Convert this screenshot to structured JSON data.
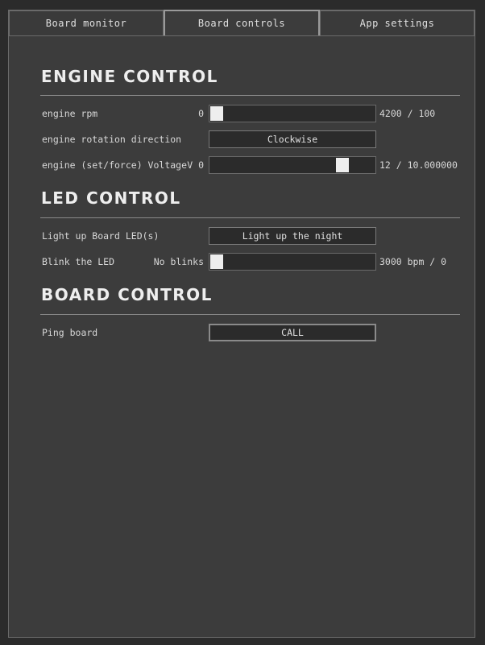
{
  "tabs": [
    {
      "label": "Board monitor"
    },
    {
      "label": "Board controls"
    },
    {
      "label": "App settings"
    }
  ],
  "engine": {
    "title": "ENGINE CONTROL",
    "rpm": {
      "label": "engine rpm",
      "min": "0",
      "value_text": "4200 / 100",
      "fraction": 0.0
    },
    "direction": {
      "label": "engine rotation direction",
      "button": "Clockwise"
    },
    "voltage": {
      "label": "engine (set/force) Voltage",
      "min": "V 0",
      "value_text": "12 / 10.000000",
      "fraction": 0.83
    }
  },
  "led": {
    "title": "LED CONTROL",
    "light": {
      "label": "Light up Board LED(s)",
      "button": "Light up the night"
    },
    "blink": {
      "label": "Blink the LED",
      "min": "No blinks",
      "value_text": "3000 bpm  / 0",
      "fraction": 0.0
    }
  },
  "board": {
    "title": "BOARD CONTROL",
    "ping": {
      "label": "Ping board",
      "button": "CALL"
    }
  }
}
